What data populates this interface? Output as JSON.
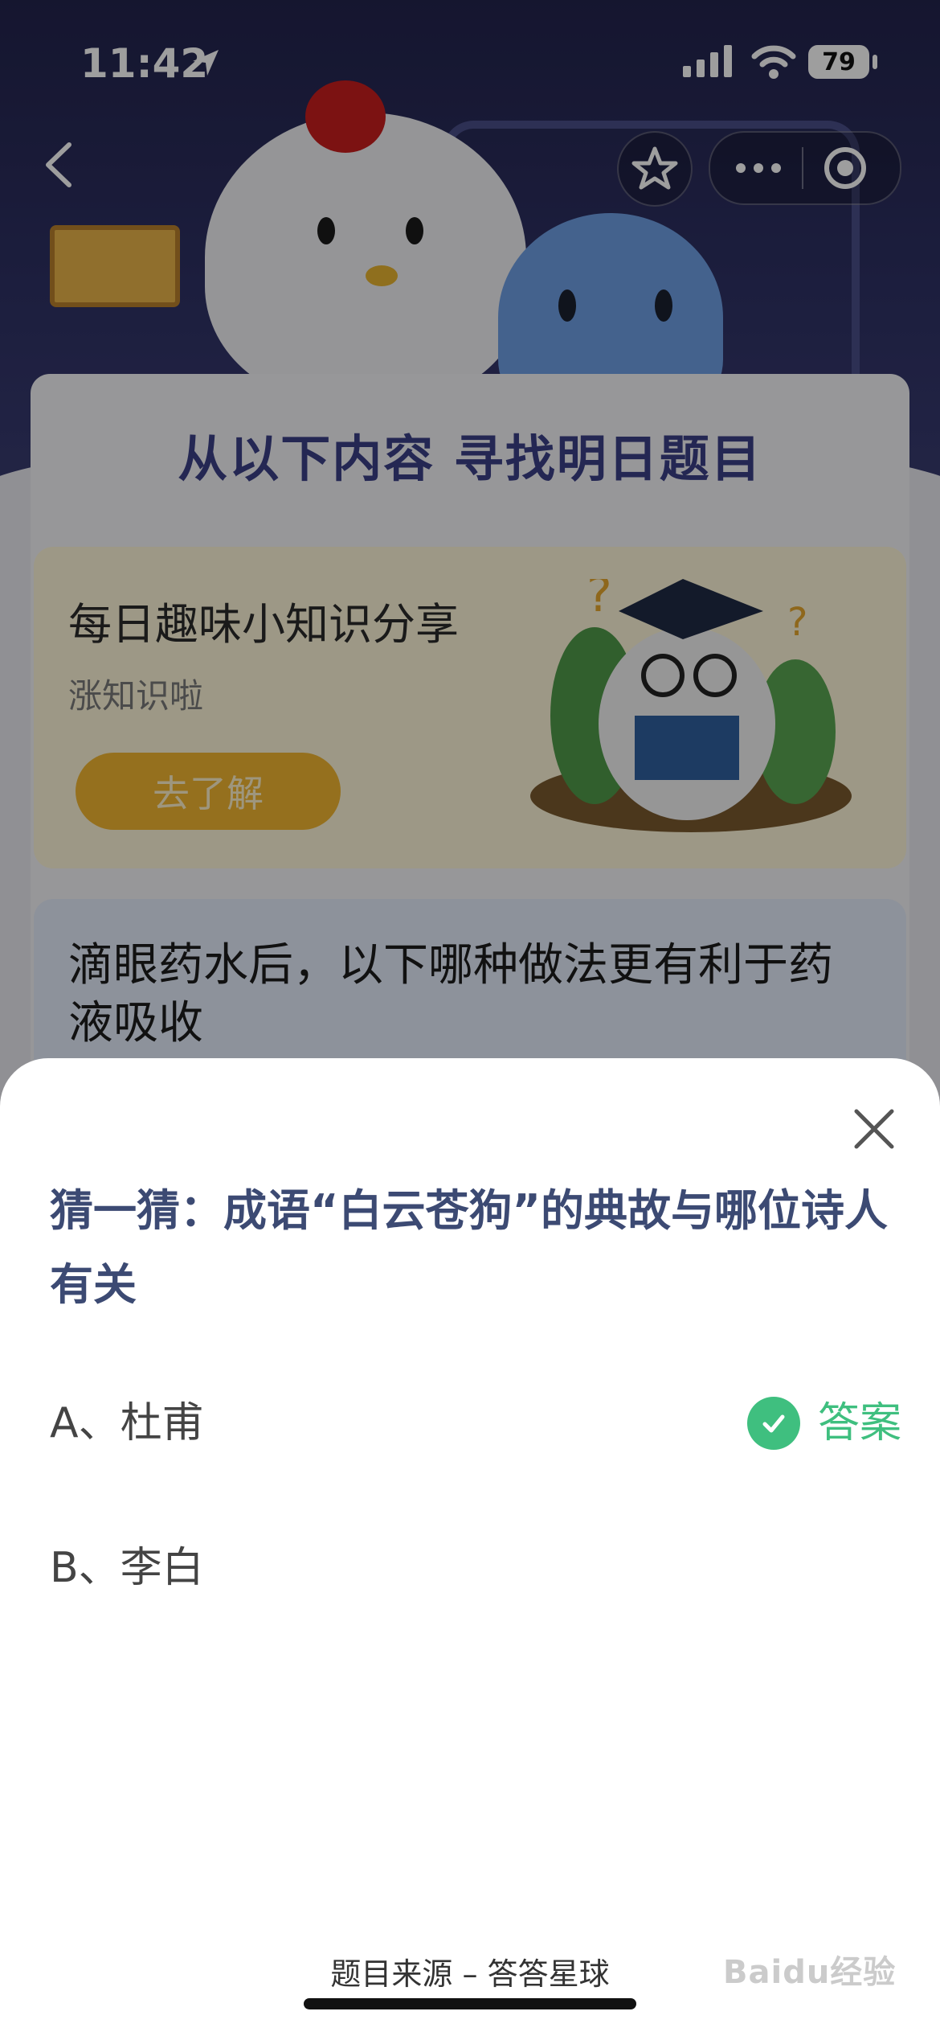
{
  "status_bar": {
    "time": "11:42",
    "battery": "79"
  },
  "background": {
    "section_title": "从以下内容 寻找明日题目",
    "share_card": {
      "title": "每日趣味小知识分享",
      "subtitle": "涨知识啦",
      "button": "去了解"
    },
    "question_card": {
      "text": "滴眼药水后，以下哪种做法更有利于药液吸收"
    }
  },
  "sheet": {
    "question": "猜一猜：成语“白云苍狗”的典故与哪位诗人有关",
    "options": [
      {
        "label": "A、杜甫",
        "answer_tag": "答案"
      },
      {
        "label": "B、李白"
      }
    ],
    "source": "题目来源 – 答答星球"
  },
  "watermark": "Baidu经验",
  "colors": {
    "accent_green": "#3fbf7f",
    "question_blue": "#3c4a73",
    "hero_navy": "#23244d"
  }
}
